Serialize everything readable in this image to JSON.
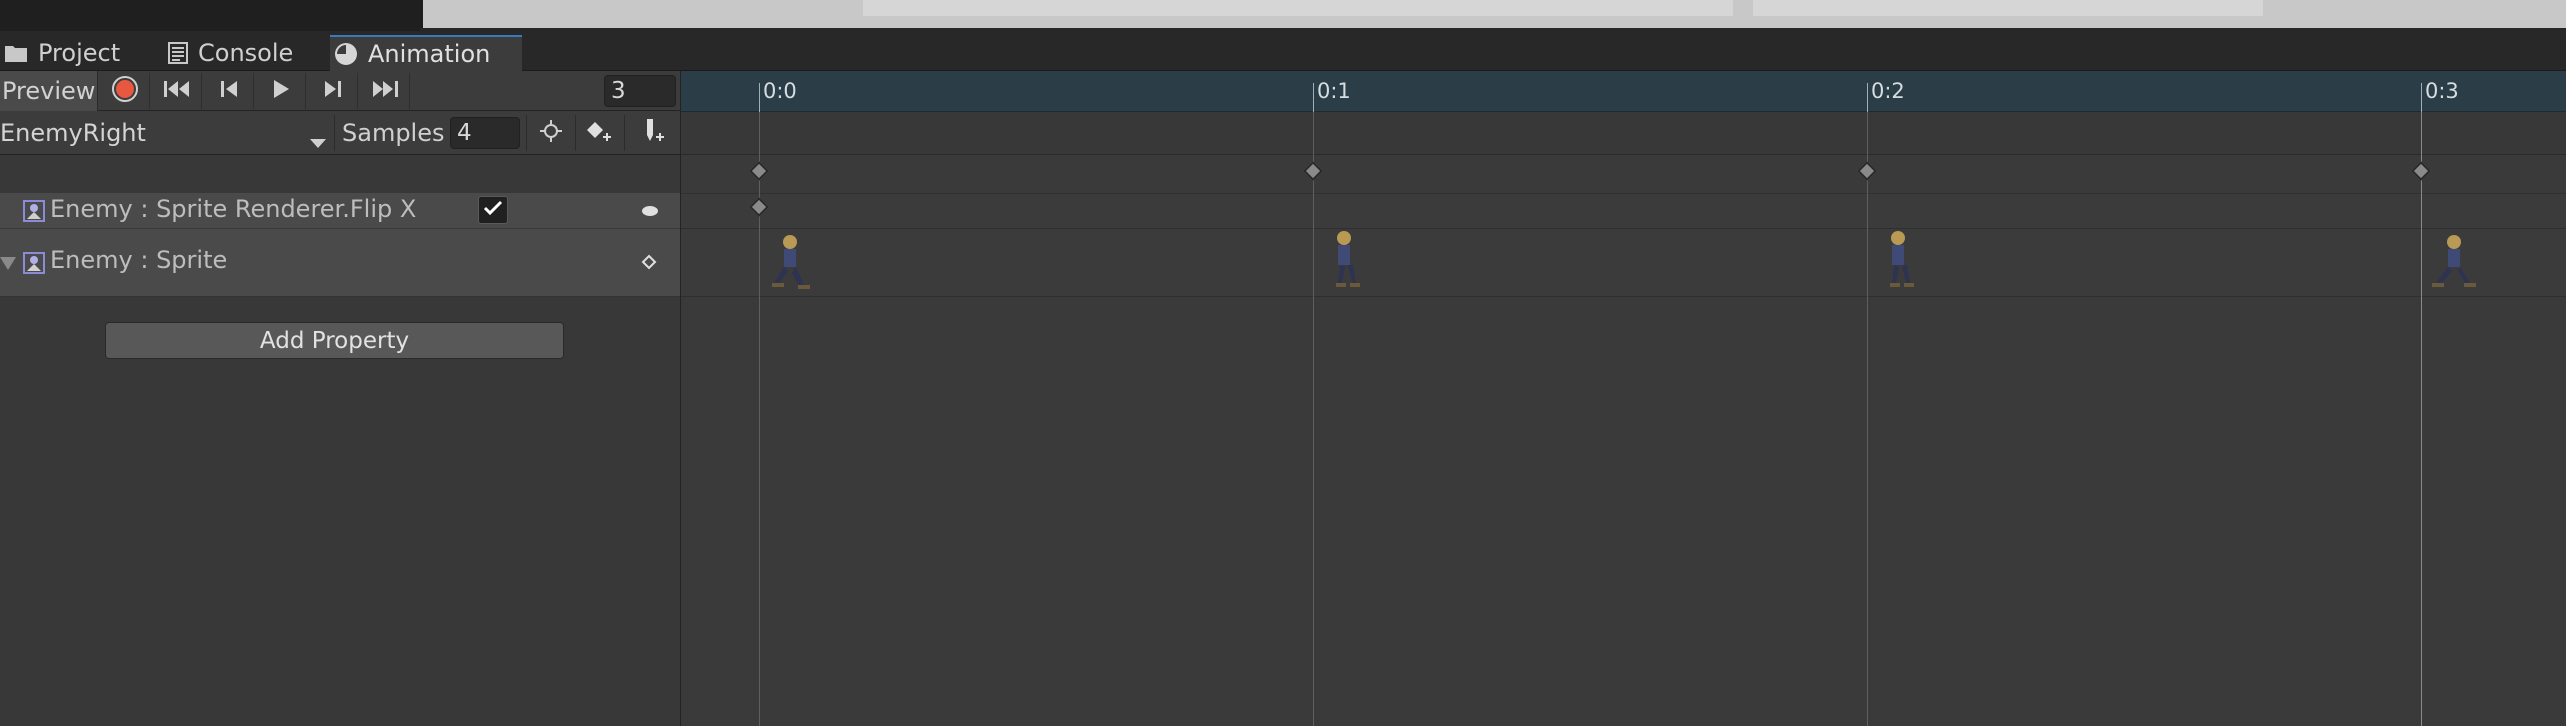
{
  "tabs": [
    {
      "label": "Project",
      "icon": "folder-icon"
    },
    {
      "label": "Console",
      "icon": "console-icon"
    },
    {
      "label": "Animation",
      "icon": "clock-icon",
      "active": true
    }
  ],
  "toolbar": {
    "preview_label": "Preview",
    "record_icon": "record-icon",
    "first_key_icon": "first-keyframe-icon",
    "prev_key_icon": "previous-keyframe-icon",
    "play_icon": "play-icon",
    "next_key_icon": "next-keyframe-icon",
    "last_key_icon": "last-keyframe-icon",
    "frame_value": "3"
  },
  "clip_bar": {
    "clip_name": "EnemyRight",
    "samples_label": "Samples",
    "samples_value": "4",
    "filter_icon": "crosshair-icon",
    "add_keyframe_icon": "add-keyframe-icon",
    "add_event_icon": "add-event-icon"
  },
  "timeline": {
    "ticks": [
      "0:0",
      "0:1",
      "0:2",
      "0:3"
    ]
  },
  "properties": [
    {
      "label": "Enemy : Sprite Renderer.Flip X",
      "icon": "sprite-renderer-icon",
      "value": true
    },
    {
      "label": "Enemy : Sprite",
      "icon": "sprite-renderer-icon",
      "expanded": false
    }
  ],
  "add_property_label": "Add Property",
  "colors": {
    "accent": "#3a79bb",
    "record": "#e8573f",
    "ruler_bg": "#2b3e47"
  }
}
